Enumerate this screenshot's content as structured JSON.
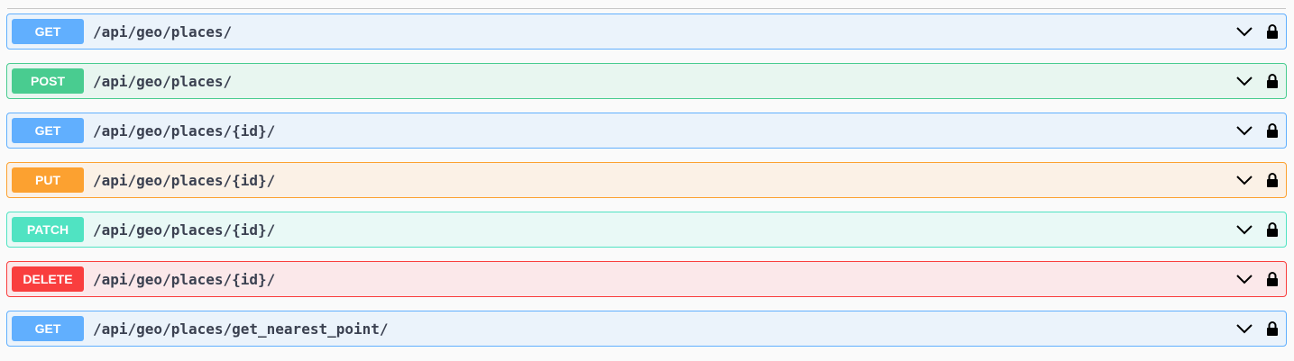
{
  "operations": [
    {
      "method": "GET",
      "path": "/api/geo/places/",
      "color": "#61affe",
      "bg": "#ebf3fb",
      "border": "#61affe"
    },
    {
      "method": "POST",
      "path": "/api/geo/places/",
      "color": "#49cc90",
      "bg": "#e8f6f0",
      "border": "#49cc90"
    },
    {
      "method": "GET",
      "path": "/api/geo/places/{id}/",
      "color": "#61affe",
      "bg": "#ebf3fb",
      "border": "#61affe"
    },
    {
      "method": "PUT",
      "path": "/api/geo/places/{id}/",
      "color": "#fca130",
      "bg": "#fbf1e6",
      "border": "#fca130"
    },
    {
      "method": "PATCH",
      "path": "/api/geo/places/{id}/",
      "color": "#50e3c2",
      "bg": "#e9f9f6",
      "border": "#50e3c2"
    },
    {
      "method": "DELETE",
      "path": "/api/geo/places/{id}/",
      "color": "#f93e3e",
      "bg": "#fbe8ea",
      "border": "#f93e3e"
    },
    {
      "method": "GET",
      "path": "/api/geo/places/get_nearest_point/",
      "color": "#61affe",
      "bg": "#ebf3fb",
      "border": "#61affe"
    }
  ],
  "icons": {
    "expand": "chevron-down-icon",
    "auth": "lock-icon"
  }
}
